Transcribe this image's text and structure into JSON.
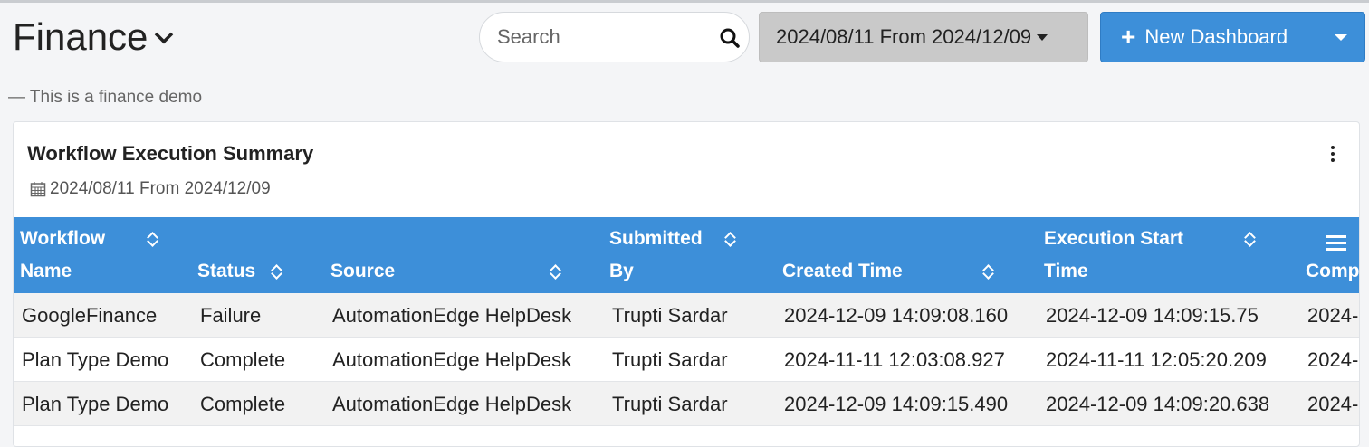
{
  "header": {
    "title": "Finance",
    "search_placeholder": "Search",
    "date_range": "2024/08/11 From 2024/12/09",
    "new_dashboard_label": "New Dashboard"
  },
  "subtitle": "— This is a finance demo",
  "card": {
    "title": "Workflow Execution Summary",
    "date_range": "2024/08/11 From 2024/12/09",
    "columns": [
      {
        "line1": "Workflow",
        "line2": "Name"
      },
      {
        "line1": "",
        "line2": "Status"
      },
      {
        "line1": "",
        "line2": "Source"
      },
      {
        "line1": "Submitted",
        "line2": "By"
      },
      {
        "line1": "",
        "line2": "Created Time"
      },
      {
        "line1": "Execution Start",
        "line2": "Time"
      },
      {
        "line1": "",
        "line2": "Comp"
      }
    ],
    "rows": [
      {
        "workflow": "GoogleFinance",
        "status": "Failure",
        "source": "AutomationEdge HelpDesk",
        "submitted_by": "Trupti Sardar",
        "created": "2024-12-09 14:09:08.160",
        "exec_start": "2024-12-09 14:09:15.75",
        "comp": "2024-"
      },
      {
        "workflow": "Plan Type Demo",
        "status": "Complete",
        "source": "AutomationEdge HelpDesk",
        "submitted_by": "Trupti Sardar",
        "created": "2024-11-11 12:03:08.927",
        "exec_start": "2024-11-11 12:05:20.209",
        "comp": "2024-"
      },
      {
        "workflow": "Plan Type Demo",
        "status": "Complete",
        "source": "AutomationEdge HelpDesk",
        "submitted_by": "Trupti Sardar",
        "created": "2024-12-09 14:09:15.490",
        "exec_start": "2024-12-09 14:09:20.638",
        "comp": "2024-"
      }
    ]
  },
  "colors": {
    "accent": "#3d8fd9",
    "date_button_bg": "#c9c9c9",
    "page_bg": "#f4f5f7"
  },
  "icons": [
    "chevron-down-icon",
    "search-icon",
    "caret-down-icon",
    "plus-icon",
    "calendar-icon",
    "kebab-menu-icon",
    "sort-icon",
    "column-menu-icon"
  ]
}
